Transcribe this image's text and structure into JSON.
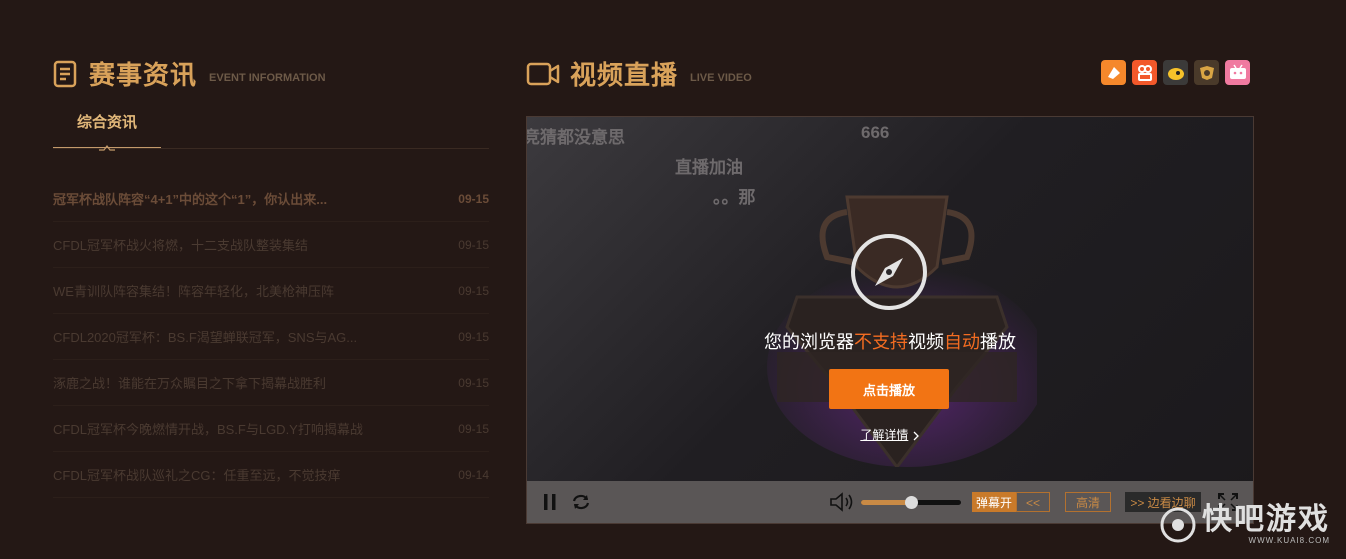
{
  "news": {
    "title": "赛事资讯",
    "subtitle": "EVENT INFORMATION",
    "tab_label": "综合资讯",
    "items": [
      {
        "title": "冠军杯战队阵容“4+1”中的这个“1”，你认出来...",
        "date": "09-15"
      },
      {
        "title": "CFDL冠军杯战火将燃，十二支战队整装集结",
        "date": "09-15"
      },
      {
        "title": "WE青训队阵容集结！阵容年轻化，北美枪神压阵",
        "date": "09-15"
      },
      {
        "title": "CFDL2020冠军杯：BS.F渴望蝉联冠军，SNS与AG...",
        "date": "09-15"
      },
      {
        "title": "涿鹿之战！谁能在万众瞩目之下拿下揭幕战胜利",
        "date": "09-15"
      },
      {
        "title": "CFDL冠军杯今晚燃情开战，BS.F与LGD.Y打响揭幕战",
        "date": "09-15"
      },
      {
        "title": "CFDL冠军杯战队巡礼之CG：任重至远，不觉技痒",
        "date": "09-14"
      }
    ]
  },
  "video": {
    "title": "视频直播",
    "subtitle": "LIVE VIDEO",
    "platforms": [
      {
        "icon": "huya-icon",
        "color": "#f5882b"
      },
      {
        "icon": "kuaishou-icon",
        "color": "#f2582a"
      },
      {
        "icon": "douyu-icon",
        "color": "#3b3a39"
      },
      {
        "icon": "egame-icon",
        "color": "#4a3a2a"
      },
      {
        "icon": "bilibili-icon",
        "color": "#f07aa0"
      }
    ],
    "danmu": [
      "竞猜都没意思",
      "666",
      "直播加油",
      "。。那"
    ],
    "notice_pre": "您的浏览器",
    "notice_hl1": "不支持",
    "notice_mid": "视频",
    "notice_hl2": "自动",
    "notice_post": "播放",
    "play_label": "点击播放",
    "learn_more": "了解详情",
    "controls": {
      "danmu_toggle": "弹幕开",
      "collapse": "<<",
      "quality": "高清",
      "side_watch": ">> 边看边聊",
      "volume_level": 0.5
    }
  },
  "watermark": {
    "text": "快吧游戏",
    "url": "WWW.KUAI8.COM"
  }
}
